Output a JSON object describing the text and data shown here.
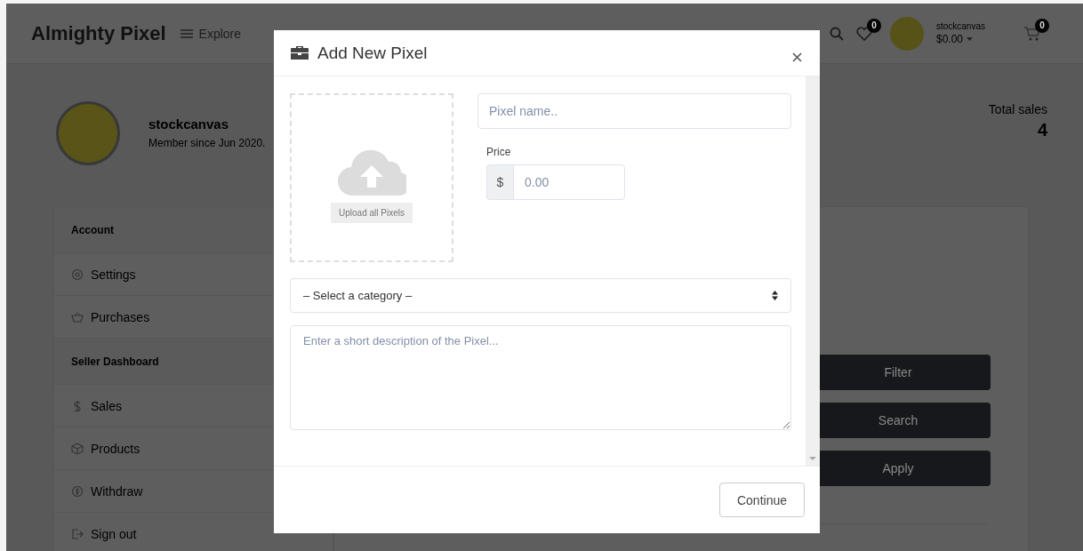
{
  "header": {
    "logo": "Almighty Pixel",
    "explore": "Explore",
    "wishlist_count": "0",
    "user": {
      "name": "stockcanvas",
      "balance": "$0.00"
    },
    "cart_count": "0"
  },
  "profile": {
    "name": "stockcanvas",
    "member_since": "Member since Jun 2020.",
    "total_sales_label": "Total sales",
    "total_sales": "4"
  },
  "sidebar": {
    "sections": [
      {
        "title": "Account",
        "items": [
          {
            "label": "Settings"
          },
          {
            "label": "Purchases"
          }
        ]
      },
      {
        "title": "Seller Dashboard",
        "items": [
          {
            "label": "Sales"
          },
          {
            "label": "Products"
          },
          {
            "label": "Withdraw"
          },
          {
            "label": "Sign out"
          }
        ]
      }
    ]
  },
  "main": {
    "buttons": [
      "Filter",
      "Search",
      "Apply"
    ]
  },
  "modal": {
    "title": "Add New Pixel",
    "upload_button": "Upload all Pixels",
    "name_placeholder": "Pixel name..",
    "price_label": "Price",
    "currency": "$",
    "price_placeholder": "0.00",
    "category": "– Select a category –",
    "description_placeholder": "Enter a short description of the Pixel...",
    "continue": "Continue"
  }
}
